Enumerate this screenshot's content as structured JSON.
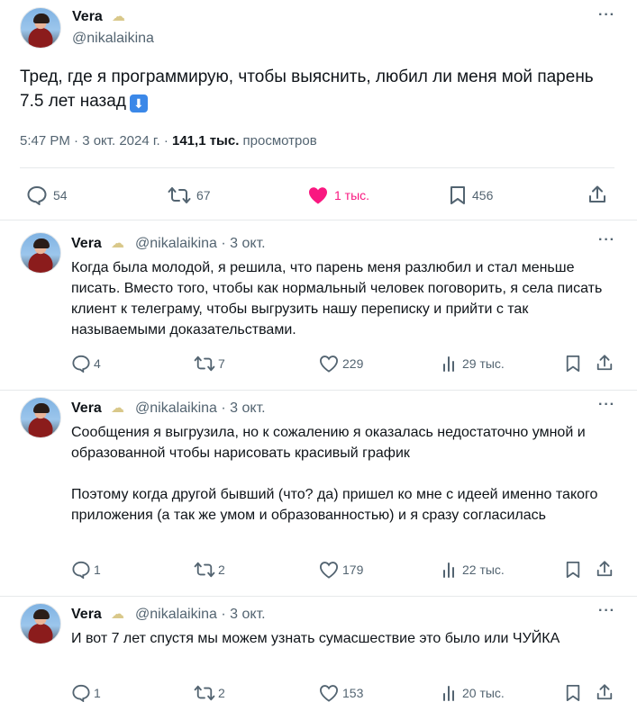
{
  "main": {
    "name": "Vera",
    "handle": "@nikalaikina",
    "text": "Тред, где я программирую, чтобы выяснить, любил ли меня мой парень 7.5 лет назад",
    "arrow_emoji": "⬇",
    "time": "5:47 PM · 3 окт. 2024 г. ·",
    "views_count": "141,1 тыс.",
    "views_label": "просмотров",
    "replies": "54",
    "reposts": "67",
    "likes": "1 тыс.",
    "bookmarks": "456",
    "more": "···"
  },
  "replies": [
    {
      "name": "Vera",
      "handle": "@nikalaikina · 3 окт.",
      "paragraphs": [
        "Когда была молодой, я решила, что парень меня разлюбил и стал меньше писать. Вместо того, чтобы как нормальный человек поговорить, я села писать клиент к телеграму, чтобы выгрузить нашу переписку и прийти с так называемыми доказательствами."
      ],
      "replies": "4",
      "reposts": "7",
      "likes": "229",
      "views": "29 тыс.",
      "more": "···"
    },
    {
      "name": "Vera",
      "handle": "@nikalaikina · 3 окт.",
      "paragraphs": [
        "Сообщения я выгрузила, но к сожалению я оказалась недостаточно умной и образованной чтобы нарисовать красивый график",
        "Поэтому когда другой бывший (что? да) пришел ко мне с идеей именно такого приложения (а так же умом и образованностью) и я сразу согласилась"
      ],
      "replies": "1",
      "reposts": "2",
      "likes": "179",
      "views": "22 тыс.",
      "more": "···"
    },
    {
      "name": "Vera",
      "handle": "@nikalaikina · 3 окт.",
      "paragraphs": [
        "И вот 7 лет спустя мы можем узнать сумасшествие это было или ЧУЙКА"
      ],
      "replies": "1",
      "reposts": "2",
      "likes": "153",
      "views": "20 тыс.",
      "more": "···"
    }
  ],
  "colors": {
    "like": "#f91880",
    "muted": "#536471",
    "text": "#0f1419",
    "divider": "#e6e9eb"
  },
  "icons": [
    "reply-icon",
    "repost-icon",
    "heart-icon",
    "views-icon",
    "bookmark-icon",
    "share-icon",
    "moon-emoji-icon",
    "down-arrow-emoji-icon",
    "more-icon"
  ]
}
